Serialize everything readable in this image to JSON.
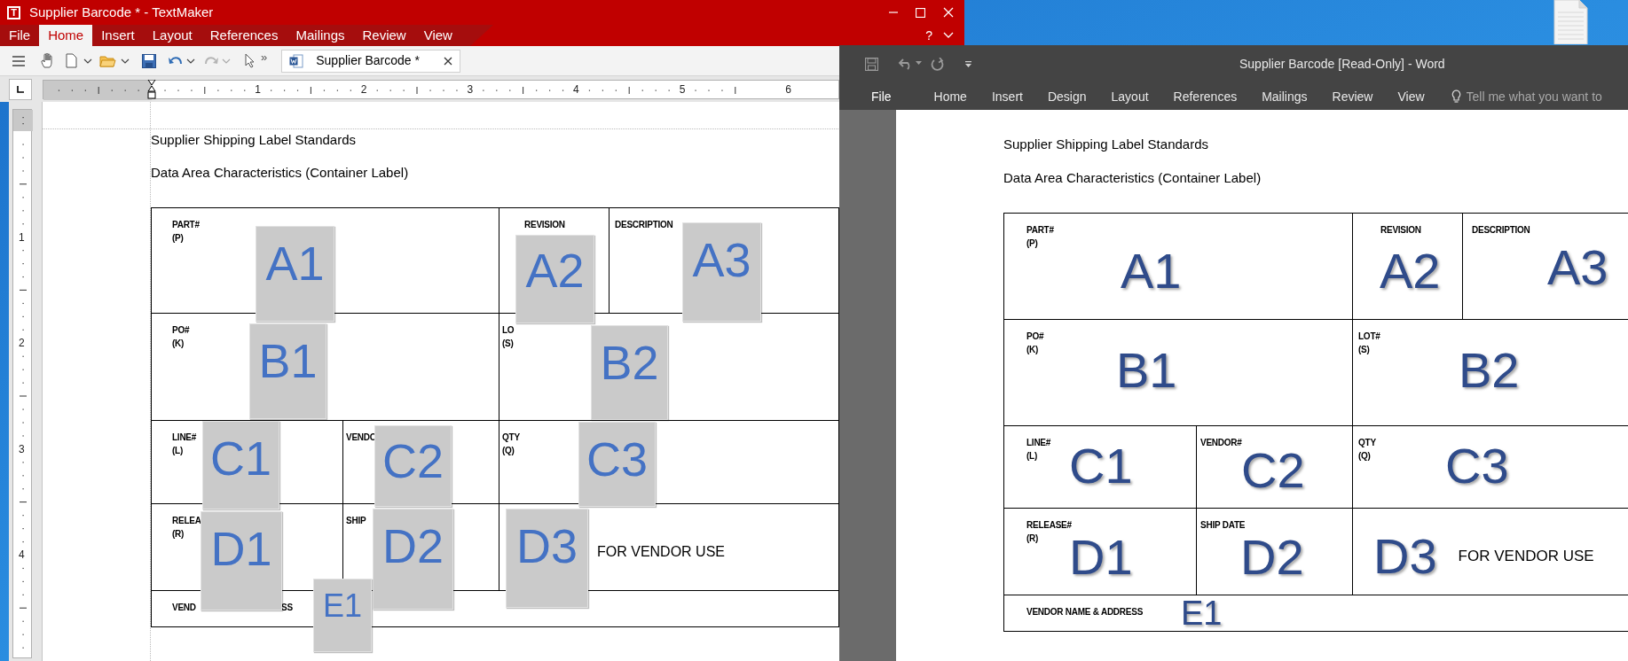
{
  "textmaker": {
    "logo": "T",
    "title": "Supplier Barcode * - TextMaker",
    "menu": [
      {
        "label": "File",
        "selected": false
      },
      {
        "label": "Home",
        "selected": true
      },
      {
        "label": "Insert",
        "selected": false
      },
      {
        "label": "Layout",
        "selected": false
      },
      {
        "label": "References",
        "selected": false
      },
      {
        "label": "Mailings",
        "selected": false
      },
      {
        "label": "Review",
        "selected": false
      },
      {
        "label": "View",
        "selected": false
      }
    ],
    "help": "?",
    "toolbar_more": "»",
    "document_tab": "Supplier Barcode *",
    "ruler": {
      "horizontal": [
        "1",
        "2",
        "3",
        "4",
        "5",
        "6"
      ],
      "vertical": [
        "1",
        "2",
        "3",
        "4"
      ]
    },
    "document": {
      "paragraphs": [
        "Supplier Shipping Label Standards",
        "Data Area Characteristics (Container Label)"
      ],
      "table": {
        "rows": [
          {
            "cells": [
              {
                "label": [
                  "PART#",
                  "(P)"
                ]
              },
              {
                "label": [
                  "REVISION"
                ]
              },
              {
                "label": [
                  "DESCRIPTION"
                ]
              }
            ]
          },
          {
            "cells": [
              {
                "label": [
                  "PO#",
                  "(K)"
                ]
              },
              {
                "label": [
                  "LO",
                  "(S)"
                ]
              }
            ]
          },
          {
            "cells": [
              {
                "label": [
                  "LINE#",
                  "(L)"
                ]
              },
              {
                "label": [
                  "VENDO"
                ]
              },
              {
                "label": [
                  "QTY",
                  "(Q)"
                ]
              }
            ]
          },
          {
            "cells": [
              {
                "label": [
                  "RELEA",
                  "(R)"
                ]
              },
              {
                "label": [
                  "SHIP"
                ]
              },
              {
                "note": "FOR VENDOR USE"
              }
            ]
          },
          {
            "cells": [
              {
                "label": [
                  "VEND"
                ],
                "tail": "SS"
              }
            ]
          }
        ]
      },
      "frames": [
        "A1",
        "A2",
        "A3",
        "B1",
        "B2",
        "C1",
        "C2",
        "C3",
        "D1",
        "D2",
        "D3",
        "E1"
      ]
    }
  },
  "word": {
    "title": "Supplier Barcode [Read-Only] - Word",
    "file_tab": "File",
    "tabs": [
      {
        "label": "Home",
        "selected": false
      },
      {
        "label": "Insert",
        "selected": false
      },
      {
        "label": "Design",
        "selected": false
      },
      {
        "label": "Layout",
        "selected": false
      },
      {
        "label": "References",
        "selected": false
      },
      {
        "label": "Mailings",
        "selected": false
      },
      {
        "label": "Review",
        "selected": false
      },
      {
        "label": "View",
        "selected": false
      }
    ],
    "tell_me": {
      "placeholder": "Tell me what you want to"
    },
    "document": {
      "paragraphs": [
        "Supplier Shipping Label Standards",
        "Data Area Characteristics (Container Label)"
      ],
      "table": {
        "rows": [
          {
            "cells": [
              {
                "label": [
                  "PART#",
                  "(P)"
                ],
                "code": "A1"
              },
              {
                "label": [
                  "REVISION"
                ],
                "code": "A2"
              },
              {
                "label": [
                  "DESCRIPTION"
                ],
                "code": "A3"
              }
            ]
          },
          {
            "cells": [
              {
                "label": [
                  "PO#",
                  "(K)"
                ],
                "code": "B1"
              },
              {
                "label": [
                  "LOT#",
                  "(S)"
                ],
                "code": "B2"
              }
            ]
          },
          {
            "cells": [
              {
                "label": [
                  "LINE#",
                  "(L)"
                ],
                "code": "C1"
              },
              {
                "label": [
                  "VENDOR#"
                ],
                "code": "C2"
              },
              {
                "label": [
                  "QTY",
                  "(Q)"
                ],
                "code": "C3"
              }
            ]
          },
          {
            "cells": [
              {
                "label": [
                  "RELEASE#",
                  "(R)"
                ],
                "code": "D1"
              },
              {
                "label": [
                  "SHIP DATE"
                ],
                "code": "D2"
              },
              {
                "code": "D3",
                "note": "FOR VENDOR USE"
              }
            ]
          },
          {
            "cells": [
              {
                "label": [
                  "VENDOR NAME & ADDRESS"
                ],
                "code": "E1"
              }
            ]
          }
        ]
      }
    }
  }
}
